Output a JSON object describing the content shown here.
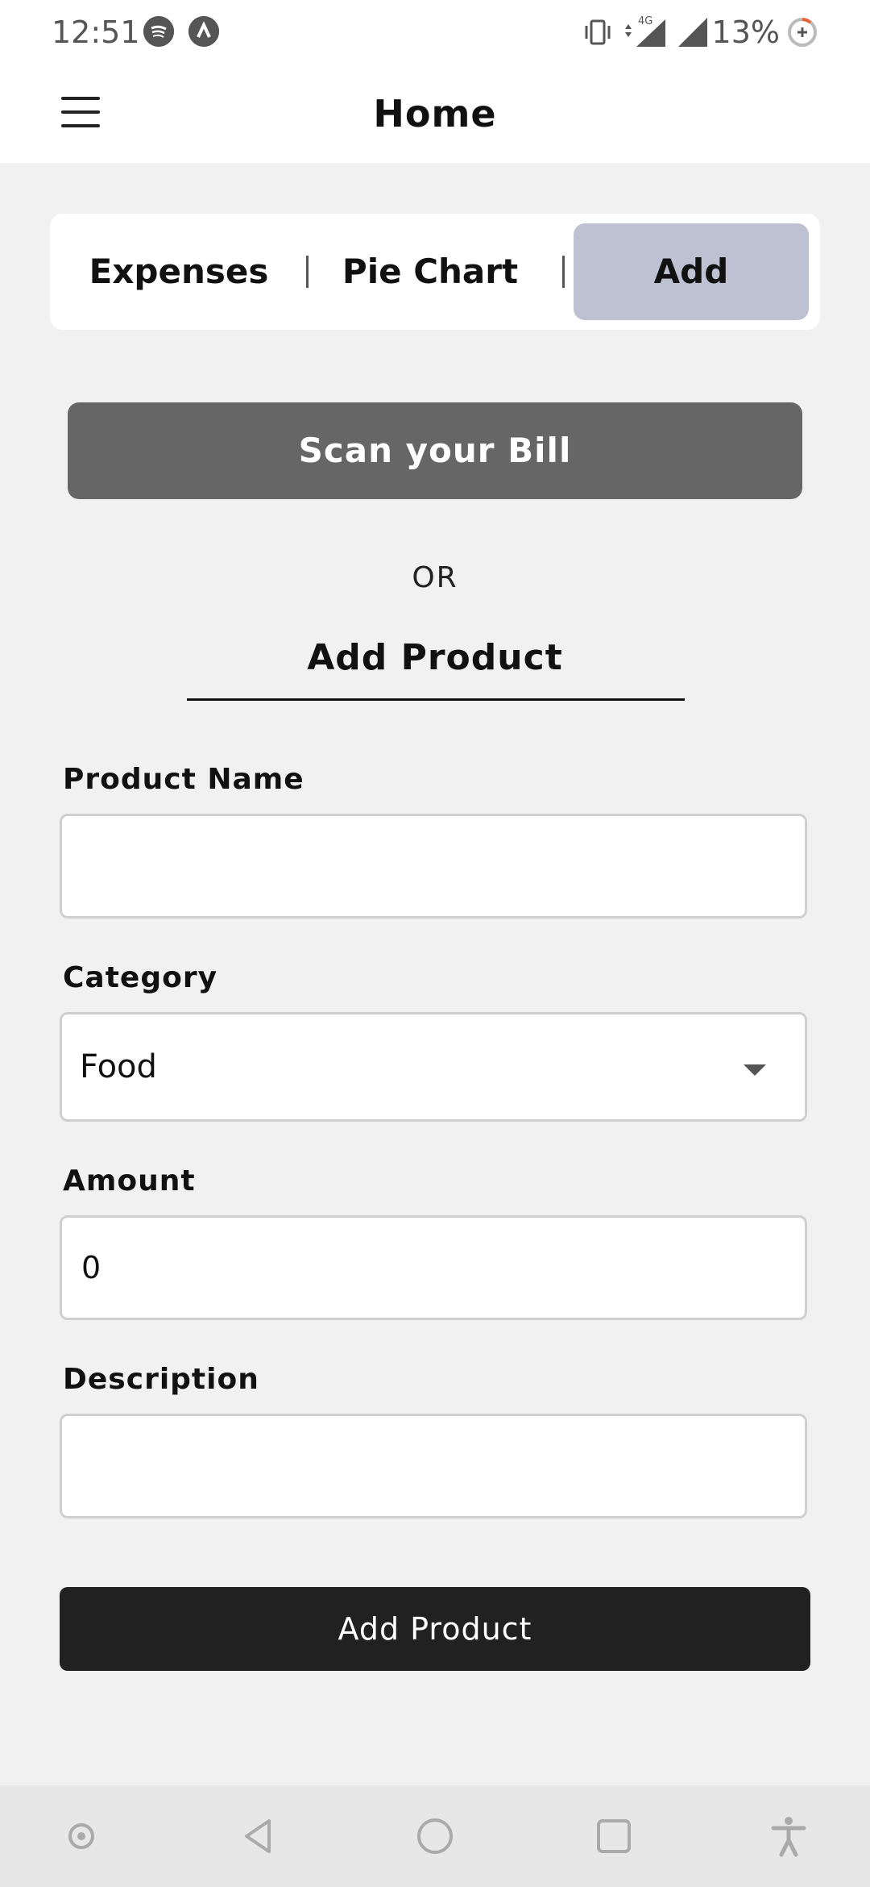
{
  "status_bar": {
    "time": "12:51",
    "battery": "13%",
    "network": "4G",
    "icons": [
      "spotify-icon",
      "arrow-up-circle-icon",
      "vibrate-icon",
      "signal-4g-icon",
      "signal-icon",
      "battery-saver-icon"
    ]
  },
  "header": {
    "title": "Home",
    "menu_icon": "hamburger-menu-icon"
  },
  "tabs": [
    {
      "label": "Expenses",
      "active": false
    },
    {
      "label": "Pie Chart",
      "active": false
    },
    {
      "label": "Add",
      "active": true
    }
  ],
  "scan": {
    "button_label": "Scan your Bill",
    "or_text": "OR"
  },
  "form": {
    "title": "Add Product",
    "product_name": {
      "label": "Product Name",
      "value": ""
    },
    "category": {
      "label": "Category",
      "value": "Food"
    },
    "amount": {
      "label": "Amount",
      "value": "0"
    },
    "description": {
      "label": "Description",
      "value": ""
    },
    "submit_label": "Add Product"
  },
  "system_nav": {
    "icons": [
      "recent-dot-icon",
      "back-icon",
      "home-icon",
      "overview-icon",
      "accessibility-icon"
    ]
  },
  "colors": {
    "active_tab": "#bdc1d2",
    "scan_button": "#666666",
    "submit_button": "#212121",
    "background": "#f1f1f1"
  }
}
